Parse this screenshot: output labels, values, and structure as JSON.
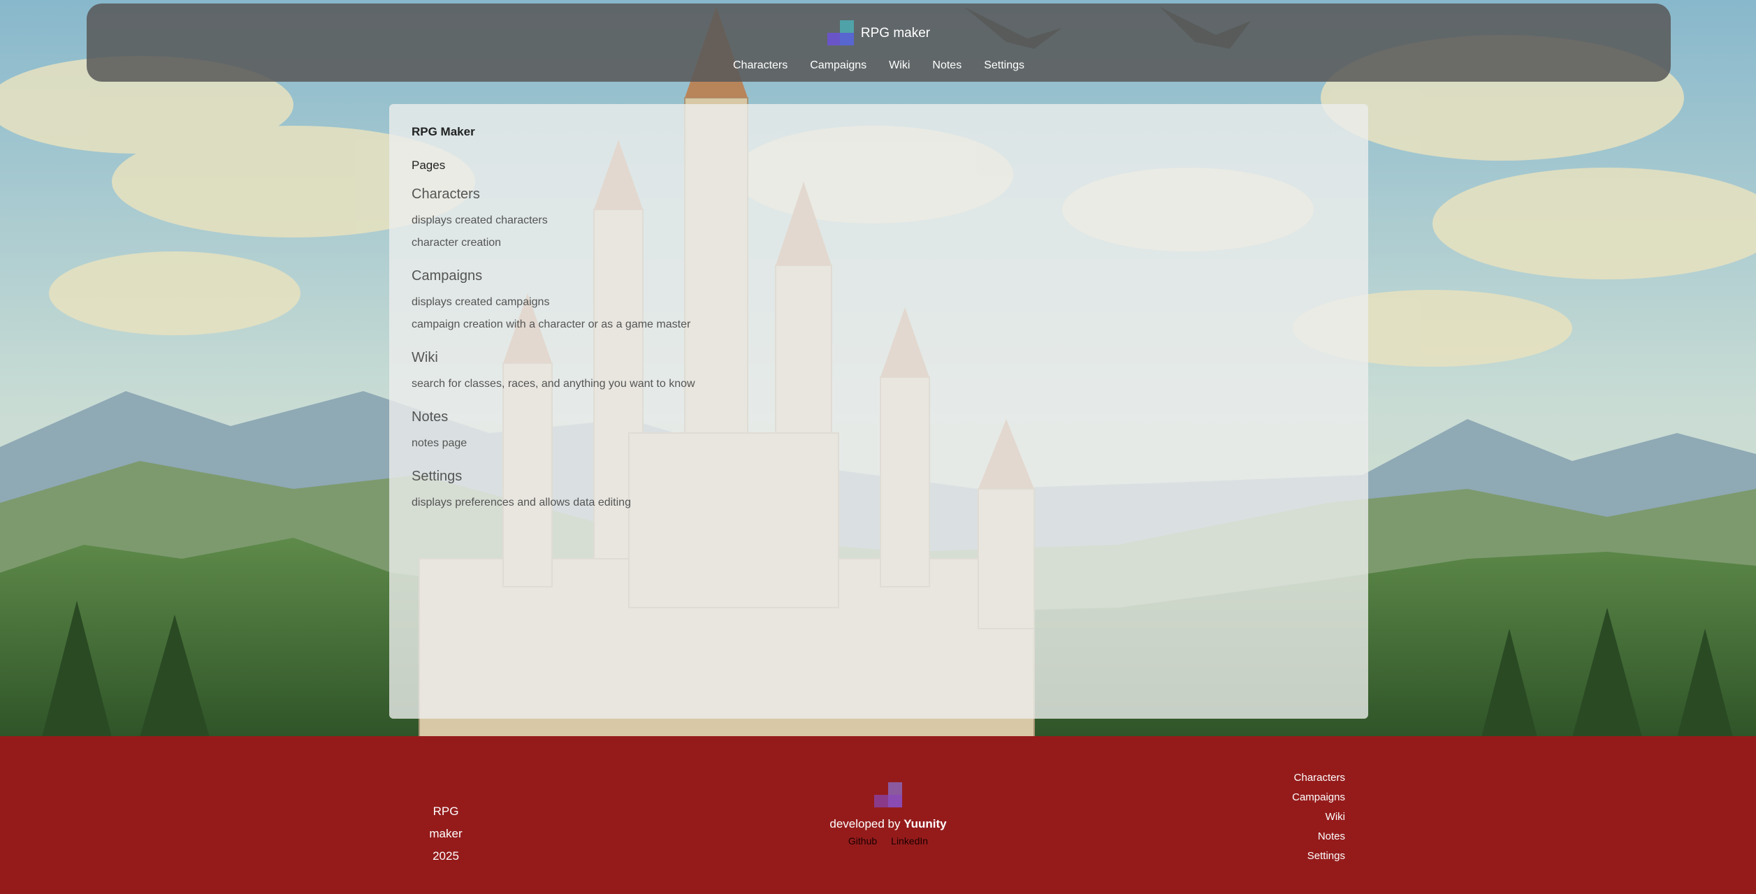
{
  "header": {
    "brand": "RPG maker",
    "nav": [
      "Characters",
      "Campaigns",
      "Wiki",
      "Notes",
      "Settings"
    ]
  },
  "main": {
    "title": "RPG Maker",
    "pages_heading": "Pages",
    "sections": [
      {
        "title": "Characters",
        "items": [
          "displays created characters",
          "character creation"
        ]
      },
      {
        "title": "Campaigns",
        "items": [
          "displays created campaigns",
          "campaign creation with a character or as a game master"
        ]
      },
      {
        "title": "Wiki",
        "items": [
          "search for classes, races, and anything you want to know"
        ]
      },
      {
        "title": "Notes",
        "items": [
          "notes page"
        ]
      },
      {
        "title": "Settings",
        "items": [
          "displays preferences and allows data editing"
        ]
      }
    ]
  },
  "footer": {
    "app_name": "RPG maker",
    "year": "2025",
    "developed_by": "developed by",
    "developer": "Yuunity",
    "links": [
      "Github",
      "LinkedIn"
    ],
    "nav": [
      "Characters",
      "Campaigns",
      "Wiki",
      "Notes",
      "Settings"
    ]
  },
  "colors": {
    "header_bg": "#585858",
    "footer_bg": "#951b1b",
    "card_bg": "#eceeec",
    "logo_teal": "#4fa2a8",
    "logo_blue": "#5866d0",
    "logo_purple": "#6a55c8"
  }
}
